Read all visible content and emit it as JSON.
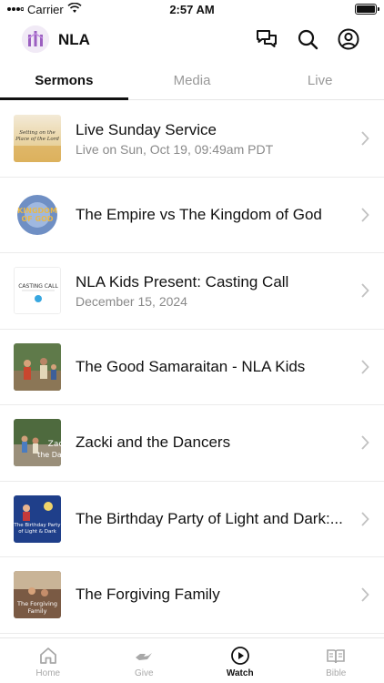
{
  "status_bar": {
    "carrier": "Carrier",
    "time": "2:57 AM"
  },
  "header": {
    "app_name": "NLA",
    "icons": [
      "chat-icon",
      "search-icon",
      "profile-icon"
    ]
  },
  "tabs": [
    {
      "label": "Sermons",
      "active": true
    },
    {
      "label": "Media",
      "active": false
    },
    {
      "label": "Live",
      "active": false
    }
  ],
  "items": [
    {
      "title": "Live Sunday Service",
      "subtitle": "Live on Sun, Oct 19, 09:49am PDT",
      "thumb_text": "Setting on the Place of the Lord"
    },
    {
      "title": "The Empire vs The Kingdom of God",
      "subtitle": "",
      "thumb_text": "KINGDOM OF GOD"
    },
    {
      "title": "NLA Kids Present: Casting Call",
      "subtitle": "December 15, 2024",
      "thumb_text": "CASTING CALL"
    },
    {
      "title": "The Good Samaraitan - NLA Kids",
      "subtitle": "",
      "thumb_text": ""
    },
    {
      "title": "Zacki and the Dancers",
      "subtitle": "",
      "thumb_text": "Zac the Dan"
    },
    {
      "title": "The Birthday Party of Light and Dark:...",
      "subtitle": "",
      "thumb_text": "The Birthday Party of Light & Dark"
    },
    {
      "title": "The Forgiving Family",
      "subtitle": "",
      "thumb_text": "The Forgiving Family"
    }
  ],
  "bottom_nav": [
    {
      "label": "Home",
      "icon": "home-icon",
      "active": false
    },
    {
      "label": "Give",
      "icon": "give-icon",
      "active": false
    },
    {
      "label": "Watch",
      "icon": "watch-icon",
      "active": true
    },
    {
      "label": "Bible",
      "icon": "bible-icon",
      "active": false
    }
  ],
  "colors": {
    "accent": "#111111",
    "inactive": "#a8a8a8",
    "brand_purple": "#9b5fc0"
  }
}
